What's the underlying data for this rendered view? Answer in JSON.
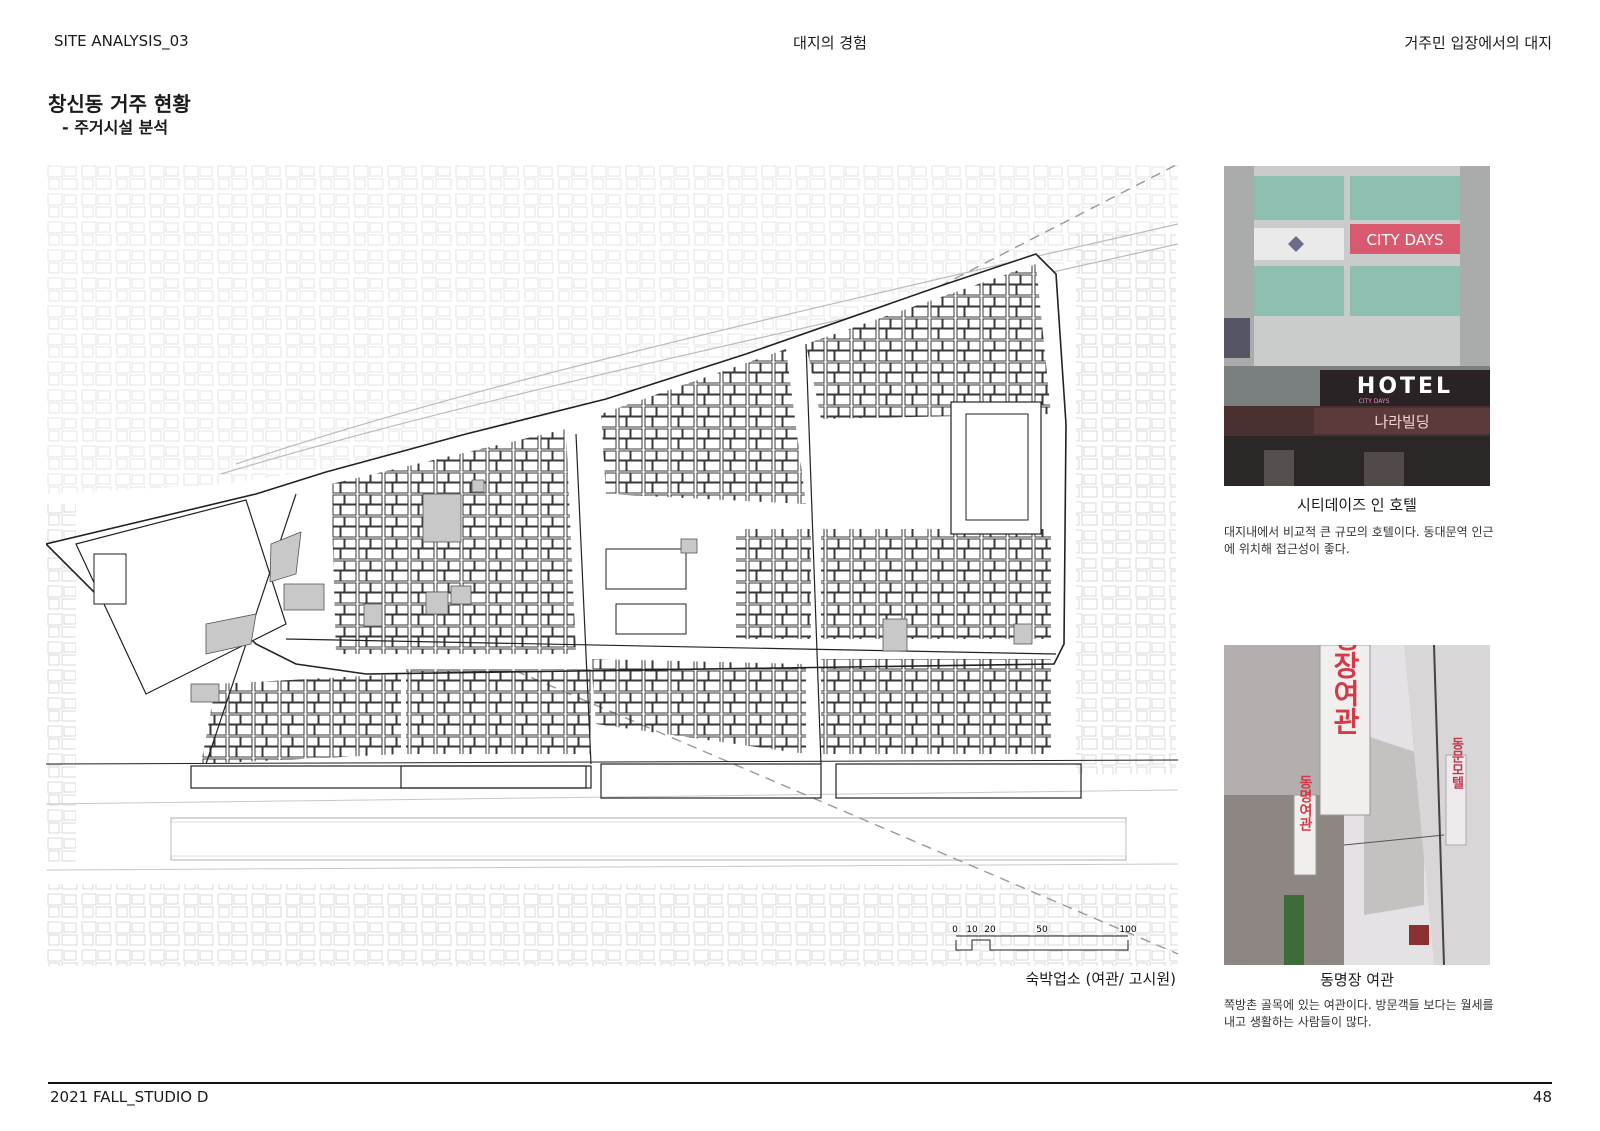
{
  "header": {
    "left": "SITE ANALYSIS_03",
    "center": "대지의 경험",
    "right": "거주민 입장에서의 대지"
  },
  "title": "창신동 거주 현황",
  "subtitle": "- 주거시설 분석",
  "map": {
    "legend": "숙박업소 (여관/ 고시원)",
    "scale_labels": [
      "0",
      "10",
      "20",
      "50",
      "100"
    ],
    "highlight_color": "#c8c8c8"
  },
  "photos": [
    {
      "caption": "시티데이즈 인 호텔",
      "description": "대지내에서 비교적 큰 규모의 호텔이다. 동대문역 인근에 위치해 접근성이 좋다.",
      "signs": {
        "sign_top": "CITY DAYS",
        "hotel": "HOTEL",
        "band": "CITY DAYS",
        "building": "나라빌딩"
      }
    },
    {
      "caption": "동명장 여관",
      "description": "쪽방촌 골목에 있는 여관이다. 방문객들 보다는 월세를 내고 생활하는 사람들이 많다.",
      "signs": {
        "big": "동명장여관",
        "small": "동명여관",
        "right": "동문모텔"
      }
    }
  ],
  "footer": {
    "left": "2021 FALL_STUDIO D",
    "page": "48"
  }
}
